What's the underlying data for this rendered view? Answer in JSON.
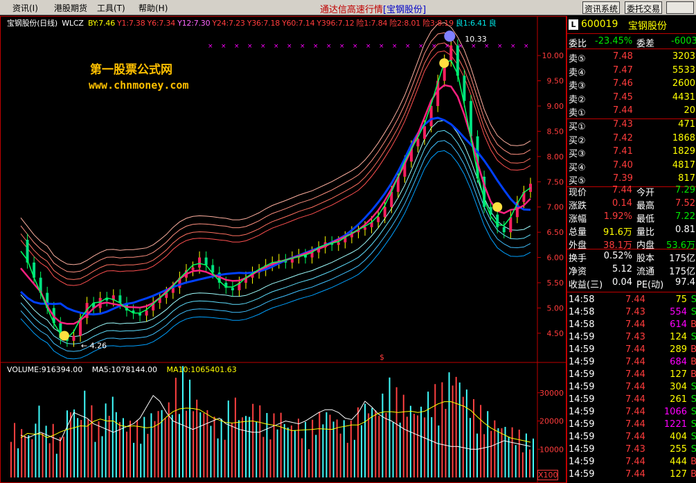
{
  "menu": {
    "items": [
      "资讯(I)",
      "港股期货",
      "工具(T)",
      "帮助(H)"
    ],
    "title_main": "通达信高速行情",
    "title_stock": "[宝钢股份]",
    "btn_info": "资讯系统",
    "btn_trade": "委托交易"
  },
  "chart_header": {
    "name": "宝钢股份(日线)",
    "formula": "WLCZ",
    "values": [
      {
        "label": "BY:7.46",
        "color": "#ffff00"
      },
      {
        "label": "Y1:7.38",
        "color": "#ff3c3c"
      },
      {
        "label": "Y6:7.34",
        "color": "#ff3c3c"
      },
      {
        "label": "Y12:7.30",
        "color": "#ff66ff"
      },
      {
        "label": "Y24:7.23",
        "color": "#ff3c3c"
      },
      {
        "label": "Y36:7.18",
        "color": "#ff3c3c"
      },
      {
        "label": "Y60:7.14",
        "color": "#ff3c3c"
      },
      {
        "label": "Y396:7.12",
        "color": "#ff3c3c"
      },
      {
        "label": "险1:7.84",
        "color": "#ff3c3c"
      },
      {
        "label": "险2:8.01",
        "color": "#ff3c3c"
      },
      {
        "label": "险3:8.19",
        "color": "#ff3c3c"
      },
      {
        "label": "良1:6.41",
        "color": "#00e6e6"
      },
      {
        "label": "良",
        "color": "#00e6e6"
      }
    ]
  },
  "watermark": {
    "line1": "第一股票公式网",
    "line2": "www.chnmoney.com"
  },
  "price_axis": {
    "ticks": [
      "10.00",
      "9.50",
      "9.00",
      "8.50",
      "8.00",
      "7.50",
      "7.00",
      "6.50",
      "6.00",
      "5.50",
      "5.00",
      "4.50"
    ],
    "high_label": "10.33",
    "low_label": "4.26",
    "dollar_marker": "$"
  },
  "volume_header": {
    "volume": "VOLUME:916394.00",
    "ma5": "MA5:1078144.00",
    "ma10": "MA10:1065401.63"
  },
  "volume_axis": {
    "ticks": [
      "30000",
      "20000",
      "10000"
    ],
    "scale": "X100"
  },
  "chart_data": {
    "type": "line",
    "price_range": [
      4.1,
      10.4
    ],
    "close": [
      6.35,
      5.9,
      5.6,
      5.3,
      5.0,
      4.7,
      4.4,
      4.35,
      4.45,
      4.8,
      5.1,
      5.0,
      5.2,
      5.15,
      5.25,
      5.1,
      4.95,
      4.9,
      4.85,
      4.95,
      5.1,
      5.2,
      5.3,
      5.4,
      5.6,
      5.75,
      5.8,
      6.0,
      5.85,
      5.7,
      5.5,
      5.4,
      5.35,
      5.5,
      5.6,
      5.7,
      5.75,
      5.85,
      5.9,
      5.95,
      5.9,
      6.0,
      6.05,
      6.0,
      6.1,
      6.2,
      6.3,
      6.25,
      6.3,
      6.4,
      6.5,
      6.55,
      6.6,
      6.7,
      6.8,
      7.0,
      7.3,
      7.6,
      7.9,
      8.2,
      8.35,
      8.6,
      9.0,
      9.5,
      9.9,
      10.2,
      9.6,
      9.1,
      8.4,
      7.6,
      7.0,
      6.85,
      6.6,
      6.5,
      6.8,
      7.1,
      7.3,
      7.46
    ],
    "volume": [
      180,
      120,
      150,
      110,
      220,
      140,
      160,
      90,
      180,
      230,
      170,
      260,
      190,
      150,
      210,
      240,
      180,
      170,
      150,
      160,
      170,
      190,
      210,
      200,
      260,
      310,
      290,
      240,
      210,
      200,
      170,
      160,
      210,
      230,
      180,
      200,
      220,
      190,
      170,
      180,
      190,
      150,
      170,
      160,
      140,
      180,
      190,
      200,
      170,
      160,
      150,
      190,
      210,
      220,
      200,
      250,
      280,
      240,
      230,
      210,
      200,
      220,
      260,
      250,
      270,
      320,
      300,
      260,
      220,
      200,
      190,
      170,
      160,
      150,
      140,
      130,
      120,
      110
    ],
    "ma5": [
      150,
      140,
      150,
      160,
      150,
      140,
      130,
      180,
      230,
      220,
      210,
      190,
      180,
      170,
      160,
      170,
      180,
      190,
      210,
      250,
      290,
      270,
      230,
      200,
      190,
      180,
      170,
      180,
      190,
      200,
      210,
      190,
      180,
      170,
      165,
      160,
      160,
      170,
      180,
      190,
      200,
      195,
      190,
      200,
      215,
      230,
      240,
      240,
      230,
      210,
      205,
      230,
      270,
      250,
      225,
      210,
      200,
      185,
      170,
      160,
      150,
      140,
      130,
      120,
      115,
      110,
      110,
      105,
      100,
      100,
      105,
      110,
      120,
      130,
      125,
      120,
      115,
      110
    ],
    "volume_range": [
      0,
      40000
    ]
  },
  "quote": {
    "code": "600019",
    "name": "宝钢股份",
    "weibi_label": "委比",
    "weibi": "-23.45%",
    "weicha_label": "委差",
    "weicha": "-6003",
    "sell": [
      {
        "label": "卖⑤",
        "price": "7.48",
        "vol": "3203"
      },
      {
        "label": "卖④",
        "price": "7.47",
        "vol": "5533"
      },
      {
        "label": "卖③",
        "price": "7.46",
        "vol": "2600"
      },
      {
        "label": "卖②",
        "price": "7.45",
        "vol": "4431"
      },
      {
        "label": "卖①",
        "price": "7.44",
        "vol": "20"
      }
    ],
    "buy": [
      {
        "label": "买①",
        "price": "7.43",
        "vol": "471"
      },
      {
        "label": "买②",
        "price": "7.42",
        "vol": "1868"
      },
      {
        "label": "买③",
        "price": "7.41",
        "vol": "1829"
      },
      {
        "label": "买④",
        "price": "7.40",
        "vol": "4817"
      },
      {
        "label": "买⑤",
        "price": "7.39",
        "vol": "817"
      }
    ],
    "stats": [
      {
        "l1": "现价",
        "v1": "7.44",
        "c1": "red",
        "l2": "今开",
        "v2": "7.29",
        "c2": "green"
      },
      {
        "l1": "涨跌",
        "v1": "0.14",
        "c1": "red",
        "l2": "最高",
        "v2": "7.52",
        "c2": "red"
      },
      {
        "l1": "涨幅",
        "v1": "1.92%",
        "c1": "red",
        "l2": "最低",
        "v2": "7.22",
        "c2": "green"
      },
      {
        "l1": "总量",
        "v1": "91.6万",
        "c1": "yellow",
        "l2": "量比",
        "v2": "0.81",
        "c2": "white"
      },
      {
        "l1": "外盘",
        "v1": "38.1万",
        "c1": "red",
        "l2": "内盘",
        "v2": "53.6万",
        "c2": "green"
      },
      {
        "l1": "换手",
        "v1": "0.52%",
        "c1": "white",
        "l2": "股本",
        "v2": "175亿",
        "c2": "white"
      },
      {
        "l1": "净资",
        "v1": "5.12",
        "c1": "white",
        "l2": "流通",
        "v2": "175亿",
        "c2": "white"
      },
      {
        "l1": "收益(三)",
        "v1": "0.04",
        "c1": "white",
        "l2": "PE(动)",
        "v2": "97.4",
        "c2": "white"
      }
    ],
    "ticks": [
      {
        "t": "14:58",
        "p": "7.44",
        "pc": "red",
        "v": "75",
        "vc": "yellow",
        "d": "S",
        "dc": "green"
      },
      {
        "t": "14:58",
        "p": "7.43",
        "pc": "red",
        "v": "554",
        "vc": "magenta",
        "d": "S",
        "dc": "green"
      },
      {
        "t": "14:58",
        "p": "7.44",
        "pc": "red",
        "v": "614",
        "vc": "magenta",
        "d": "B",
        "dc": "red"
      },
      {
        "t": "14:59",
        "p": "7.43",
        "pc": "red",
        "v": "124",
        "vc": "yellow",
        "d": "S",
        "dc": "green"
      },
      {
        "t": "14:59",
        "p": "7.44",
        "pc": "red",
        "v": "289",
        "vc": "yellow",
        "d": "B",
        "dc": "red"
      },
      {
        "t": "14:59",
        "p": "7.44",
        "pc": "red",
        "v": "684",
        "vc": "magenta",
        "d": "B",
        "dc": "red"
      },
      {
        "t": "14:59",
        "p": "7.44",
        "pc": "red",
        "v": "127",
        "vc": "yellow",
        "d": "B",
        "dc": "red"
      },
      {
        "t": "14:59",
        "p": "7.44",
        "pc": "red",
        "v": "304",
        "vc": "yellow",
        "d": "S",
        "dc": "green"
      },
      {
        "t": "14:59",
        "p": "7.44",
        "pc": "red",
        "v": "261",
        "vc": "yellow",
        "d": "S",
        "dc": "green"
      },
      {
        "t": "14:59",
        "p": "7.44",
        "pc": "red",
        "v": "1066",
        "vc": "magenta",
        "d": "S",
        "dc": "green"
      },
      {
        "t": "14:59",
        "p": "7.44",
        "pc": "red",
        "v": "1221",
        "vc": "magenta",
        "d": "S",
        "dc": "green"
      },
      {
        "t": "14:59",
        "p": "7.44",
        "pc": "red",
        "v": "404",
        "vc": "yellow",
        "d": "S",
        "dc": "green"
      },
      {
        "t": "14:59",
        "p": "7.43",
        "pc": "red",
        "v": "255",
        "vc": "yellow",
        "d": "S",
        "dc": "green"
      },
      {
        "t": "14:59",
        "p": "7.44",
        "pc": "red",
        "v": "444",
        "vc": "yellow",
        "d": "B",
        "dc": "red"
      },
      {
        "t": "14:59",
        "p": "7.44",
        "pc": "red",
        "v": "127",
        "vc": "yellow",
        "d": "B",
        "dc": "red"
      }
    ]
  }
}
